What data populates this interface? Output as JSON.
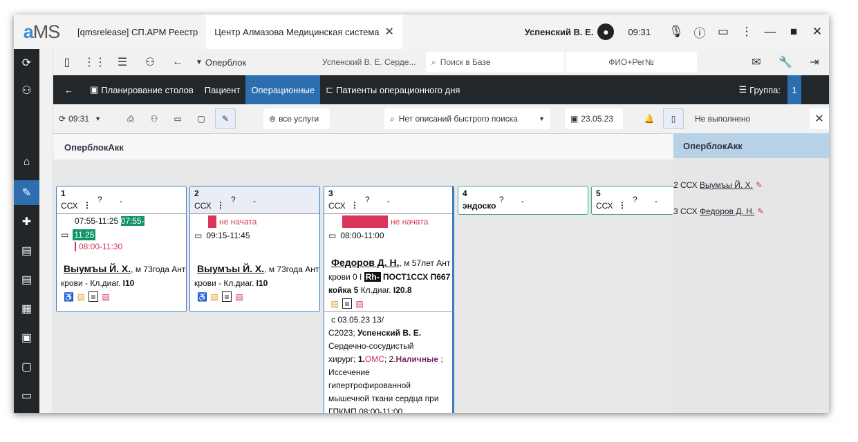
{
  "app": {
    "logo_a": "a",
    "logo_ms": "MS",
    "tab1": "[qmsrelease] СП.АРМ Реестр",
    "tab2": "Центр Алмазова Медицинская система",
    "user": "Успенский В. Е.",
    "time": "09:31"
  },
  "toolbar1": {
    "opblock": "Оперблок",
    "user_short": "Успенский В. Е. Серде...",
    "search_placeholder": "Поиск в Базе",
    "search2_placeholder": "ФИО+Рег№"
  },
  "nav": {
    "planning": "Планирование столов",
    "patient": "Пациент",
    "operations": "Операционные",
    "patients_day": "Патиенты операционного дня",
    "group_label": "Группа:",
    "group_value": "1"
  },
  "toolbar3": {
    "time": "09:31",
    "all_services": "все услуги",
    "quick_search": "Нет описаний быстрого поиска",
    "date": "23.05.23",
    "not_done": "Не выполнено"
  },
  "content": {
    "title": "ОперблокАкк"
  },
  "right_panel": {
    "title": "ОперблокАкк",
    "items": [
      {
        "prefix": "2 ССХ",
        "name": "Выумъы Й. Х."
      },
      {
        "prefix": "3 ССХ",
        "name": "Федоров Д. Н."
      }
    ]
  },
  "cards": [
    {
      "num": "1",
      "room": "ССХ",
      "q": "?",
      "dash": "-",
      "time_range": "07:55-11:25",
      "hl1": "07:55-",
      "hl2": "11:25",
      "planned": "08:00-11:30",
      "patient": "Выумъы Й. Х.",
      "info": ", м 73года Ант",
      "info2": "крови - Кл.диаг.",
      "diag": "I10"
    },
    {
      "num": "2",
      "room": "ССХ",
      "q": "?",
      "dash": "-",
      "status": "не начата",
      "time_range": "09:15-11:45",
      "patient": "Выумъы Й. Х.",
      "info": ", м 73года Ант",
      "info2": "крови - Кл.диаг.",
      "diag": "I10"
    },
    {
      "num": "3",
      "room": "ССХ",
      "q": "?",
      "dash": "-",
      "status": "не начата",
      "time_range": "08:00-11:00",
      "patient": "Федоров Д. Н.",
      "info": ", м 57лет Ант",
      "info2a": "крови 0 I",
      "rh": "Rh-",
      "info2b": "ПОСТ1ССХ П667",
      "info3": "койка 5",
      "info3b": "Кл.диаг.",
      "diag": "I20.8",
      "d1": "с 03.05.23 13/",
      "d2a": "С2023;",
      "d2b": "Успенский В. Е.",
      "d3": "Сердечно-сосудистый",
      "d4a": "хирург;",
      "d4b": "1.",
      "d4c": "ОМС",
      "d4d": "; 2.",
      "d4e": "Наличные",
      "d4f": ";",
      "d5": "Иссечение",
      "d6": "гипертрофированной",
      "d7": "мышечной ткани сердца при",
      "d8": "ГПКМП 08:00-11:00"
    },
    {
      "num": "4",
      "room": "эндоско",
      "q": "?",
      "dash": "-"
    },
    {
      "num": "5",
      "room": "ССХ",
      "q": "?",
      "dash": "-"
    }
  ]
}
